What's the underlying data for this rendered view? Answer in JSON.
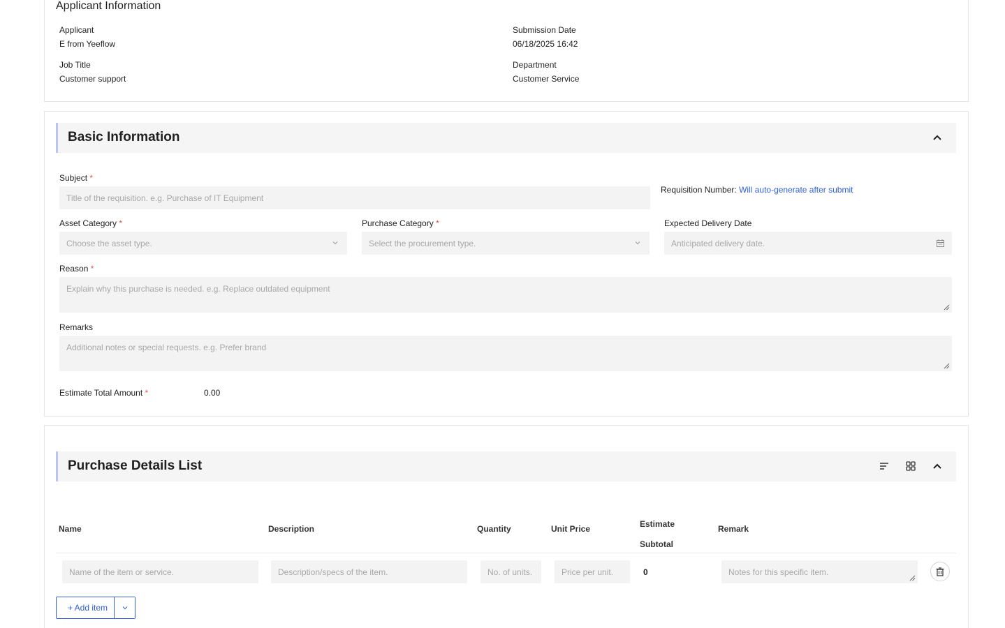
{
  "applicant_info": {
    "title": "Applicant Information",
    "applicant": {
      "label": "Applicant",
      "value": "E from Yeeflow"
    },
    "submission_date": {
      "label": "Submission Date",
      "value": "06/18/2025 16:42"
    },
    "job_title": {
      "label": "Job Title",
      "value": "Customer support"
    },
    "department": {
      "label": "Department",
      "value": "Customer Service"
    }
  },
  "basic_info": {
    "title": "Basic Information",
    "subject": {
      "label": "Subject",
      "required": "*",
      "placeholder": "Title of the requisition. e.g. Purchase of IT Equipment"
    },
    "requisition_number": {
      "label": "Requisition Number:",
      "value": "Will auto-generate after submit"
    },
    "asset_category": {
      "label": "Asset Category",
      "required": "*",
      "placeholder": "Choose the asset type."
    },
    "purchase_category": {
      "label": "Purchase Category",
      "required": "*",
      "placeholder": "Select the procurement type."
    },
    "expected_delivery": {
      "label": "Expected Delivery Date",
      "placeholder": "Anticipated delivery date."
    },
    "reason": {
      "label": "Reason",
      "required": "*",
      "placeholder": "Explain why this purchase is needed. e.g. Replace outdated equipment"
    },
    "remarks": {
      "label": "Remarks",
      "placeholder": "Additional notes or special requests. e.g. Prefer brand"
    },
    "estimate_total": {
      "label": "Estimate Total Amount",
      "required": "*",
      "value": "0.00"
    }
  },
  "details": {
    "title": "Purchase Details List",
    "columns": {
      "name": "Name",
      "description": "Description",
      "quantity": "Quantity",
      "unit_price": "Unit Price",
      "subtotal_line1": "Estimate",
      "subtotal_line2": "Subtotal",
      "remark": "Remark"
    },
    "row": {
      "name_placeholder": "Name of the item or service.",
      "description_placeholder": "Description/specs of the item.",
      "quantity_placeholder": "No. of units.",
      "unit_price_placeholder": "Price per unit.",
      "subtotal": "0",
      "remark_placeholder": "Notes for this specific item."
    },
    "add_item_label": "+ Add item"
  }
}
